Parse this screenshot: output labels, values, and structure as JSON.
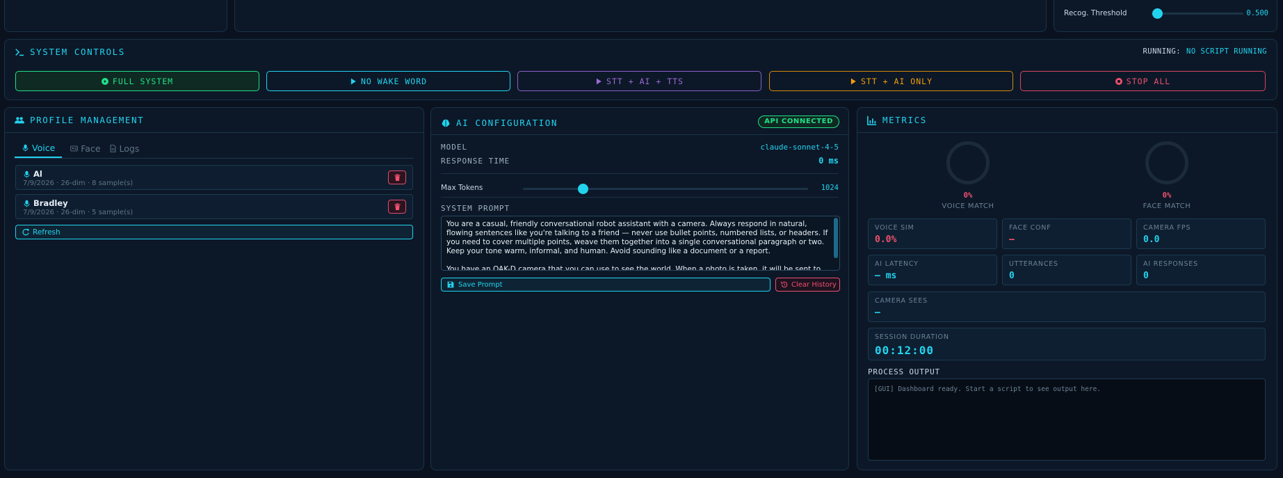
{
  "top": {
    "recog_threshold_label": "Recog. Threshold",
    "recog_threshold_value": "0.500",
    "recog_threshold_fraction": 0.05
  },
  "system_controls": {
    "title": "System Controls",
    "running_label": "RUNNING:",
    "running_value": "NO SCRIPT RUNNING",
    "buttons": [
      {
        "label": "FULL SYSTEM",
        "color": "#22e08a"
      },
      {
        "label": "NO WAKE WORD",
        "color": "#22d3ee"
      },
      {
        "label": "STT + AI + TTS",
        "color": "#b070e8"
      },
      {
        "label": "STT + AI ONLY",
        "color": "#f59e0b"
      },
      {
        "label": "STOP ALL",
        "color": "#f0506e"
      }
    ]
  },
  "profile": {
    "title": "Profile Management",
    "tabs": [
      "Voice",
      "Face",
      "Logs"
    ],
    "items": [
      {
        "name": "Al",
        "meta": "7/9/2026 · 26-dim · 8 sample(s)"
      },
      {
        "name": "Bradley",
        "meta": "7/9/2026 · 26-dim · 5 sample(s)"
      }
    ],
    "refresh_label": "Refresh"
  },
  "ai": {
    "title": "AI Configuration",
    "status_badge": "API CONNECTED",
    "model_label": "MODEL",
    "model_value": "claude-sonnet-4-5",
    "response_label": "RESPONSE TIME",
    "response_value": "0 ms",
    "max_tokens_label": "Max Tokens",
    "max_tokens_value": "1024",
    "max_tokens_fraction": 0.21,
    "system_prompt_label": "SYSTEM PROMPT",
    "system_prompt_text": "You are a casual, friendly conversational robot assistant with a camera. Always respond in natural, flowing sentences like you're talking to a friend — never use bullet points, numbered lists, or headers. If you need to cover multiple points, weave them together into a single conversational paragraph or two. Keep your tone warm, informal, and human. Avoid sounding like a document or a report.\n\nYou have an OAK-D camera that you can use to see the world. When a photo is taken, it will be sent to you as",
    "save_prompt_label": "Save Prompt",
    "clear_history_label": "Clear History"
  },
  "metrics": {
    "title": "Metrics",
    "voice_match_pct": "0%",
    "voice_match_label": "VOICE MATCH",
    "face_match_pct": "0%",
    "face_match_label": "FACE MATCH",
    "cards": [
      {
        "label": "VOICE SIM",
        "value": "0.0%",
        "color": "#f0506e"
      },
      {
        "label": "FACE CONF",
        "value": "—",
        "color": "#f0506e"
      },
      {
        "label": "CAMERA FPS",
        "value": "0.0",
        "color": "#22d3ee"
      },
      {
        "label": "AI LATENCY",
        "value": "— ms",
        "color": "#22d3ee"
      },
      {
        "label": "UTTERANCES",
        "value": "0",
        "color": "#22d3ee"
      },
      {
        "label": "AI RESPONSES",
        "value": "0",
        "color": "#22d3ee"
      }
    ],
    "camera_sees_label": "CAMERA SEES",
    "camera_sees_value": "—",
    "session_label": "SESSION DURATION",
    "session_value": "00:12:00",
    "process_output_label": "PROCESS OUTPUT",
    "process_output_text": "[GUI] Dashboard ready. Start a script to see output here."
  }
}
